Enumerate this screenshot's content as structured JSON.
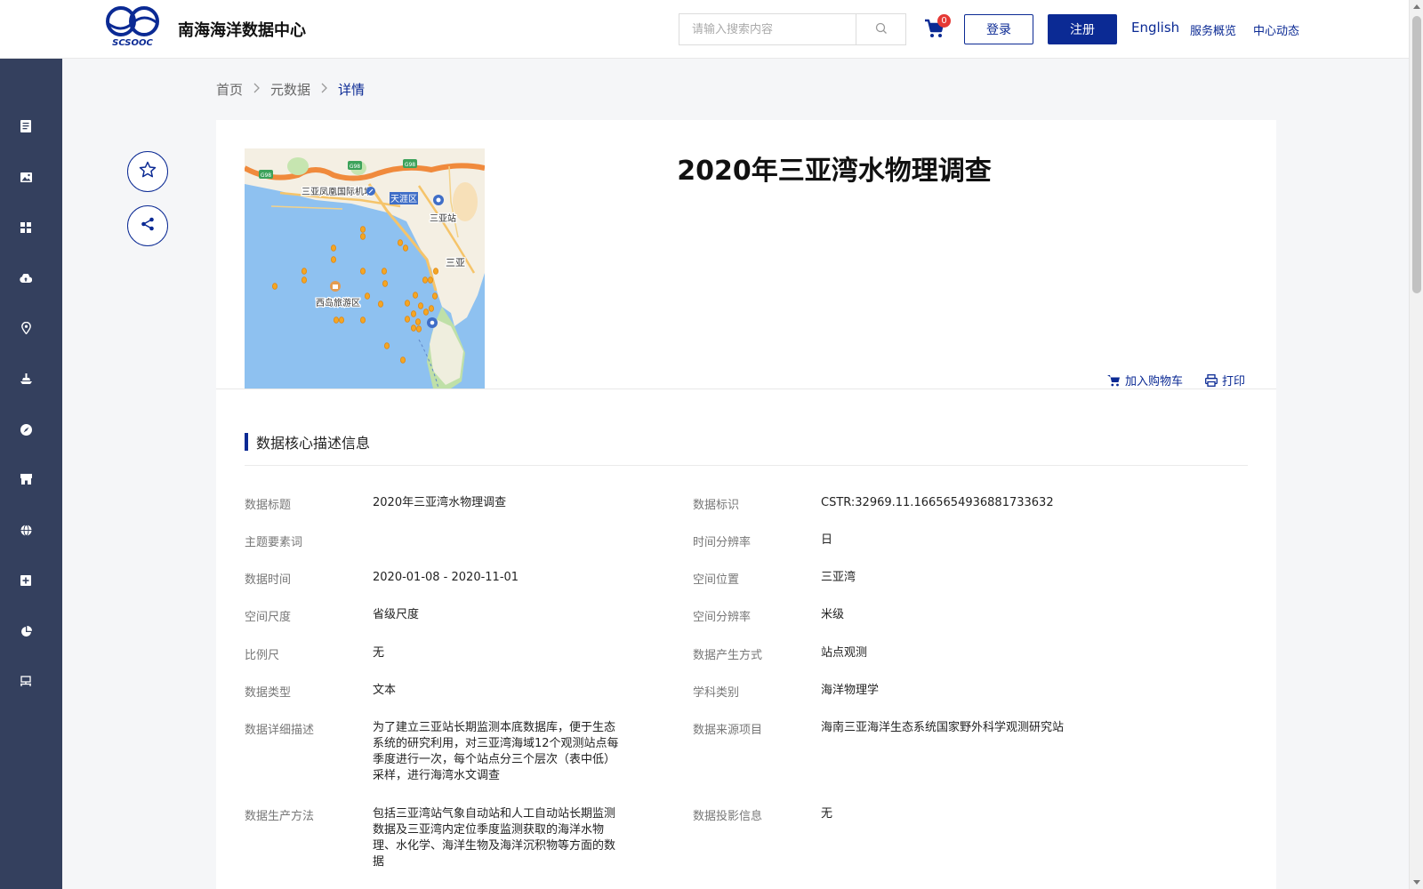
{
  "header": {
    "logo_text": "SCSOOC",
    "site_title": "南海海洋数据中心",
    "search_placeholder": "请输入搜索内容",
    "cart_count": "0",
    "login_label": "登录",
    "register_label": "注册",
    "nav": {
      "english": "English",
      "overview": "服务概览",
      "news": "中心动态"
    }
  },
  "sidebar": {
    "icons": [
      "document-icon",
      "image-icon",
      "grid-icon",
      "cloud-upload-icon",
      "location-pin-icon",
      "ship-icon",
      "compass-icon",
      "store-icon",
      "globe-icon",
      "add-box-icon",
      "pie-chart-icon",
      "network-icon"
    ]
  },
  "breadcrumb": {
    "home": "首页",
    "metadata": "元数据",
    "current": "详情",
    "separator": ">"
  },
  "map": {
    "labels": {
      "airport": "三亚凤凰国际机场",
      "tianya": "天涯区",
      "sanya_station": "三亚站",
      "sanya": "三亚",
      "xidao": "西岛旅游区",
      "road1": "G98",
      "road2": "G98",
      "road3": "G98"
    }
  },
  "dataset": {
    "title": "2020年三亚湾水物理调查",
    "add_to_cart": "加入购物车",
    "print": "打印"
  },
  "section": {
    "title": "数据核心描述信息"
  },
  "fields": {
    "left": [
      {
        "label": "数据标题",
        "value": "2020年三亚湾水物理调查"
      },
      {
        "label": "主题要素词",
        "value": ""
      },
      {
        "label": "数据时间",
        "value": "2020-01-08 - 2020-11-01"
      },
      {
        "label": "空间尺度",
        "value": "省级尺度"
      },
      {
        "label": "比例尺",
        "value": "无"
      },
      {
        "label": "数据类型",
        "value": "文本"
      },
      {
        "label": "数据详细描述",
        "value": "为了建立三亚站长期监测本底数据库，便于生态系统的研究利用，对三亚湾海域12个观测站点每季度进行一次，每个站点分三个层次（表中低）采样，进行海湾水文调查"
      },
      {
        "label": "数据生产方法",
        "value": "包括三亚湾站气象自动站和人工自动站长期监测数据及三亚湾内定位季度监测获取的海洋水物理、水化学、海洋生物及海洋沉积物等方面的数据"
      }
    ],
    "right": [
      {
        "label": "数据标识",
        "value": "CSTR:32969.11.1665654936881733632"
      },
      {
        "label": "时间分辨率",
        "value": "日"
      },
      {
        "label": "空间位置",
        "value": "三亚湾"
      },
      {
        "label": "空间分辨率",
        "value": "米级"
      },
      {
        "label": "数据产生方式",
        "value": "站点观测"
      },
      {
        "label": "学科类别",
        "value": "海洋物理学"
      },
      {
        "label": "数据来源项目",
        "value": "海南三亚海洋生态系统国家野外科学观测研究站"
      },
      {
        "label": "数据投影信息",
        "value": "无"
      }
    ]
  },
  "colors": {
    "primary": "#0b2a94",
    "sidebar": "#34405e",
    "sea": "#8ec1f0",
    "land": "#f4efe3",
    "station": "#f5a623"
  }
}
